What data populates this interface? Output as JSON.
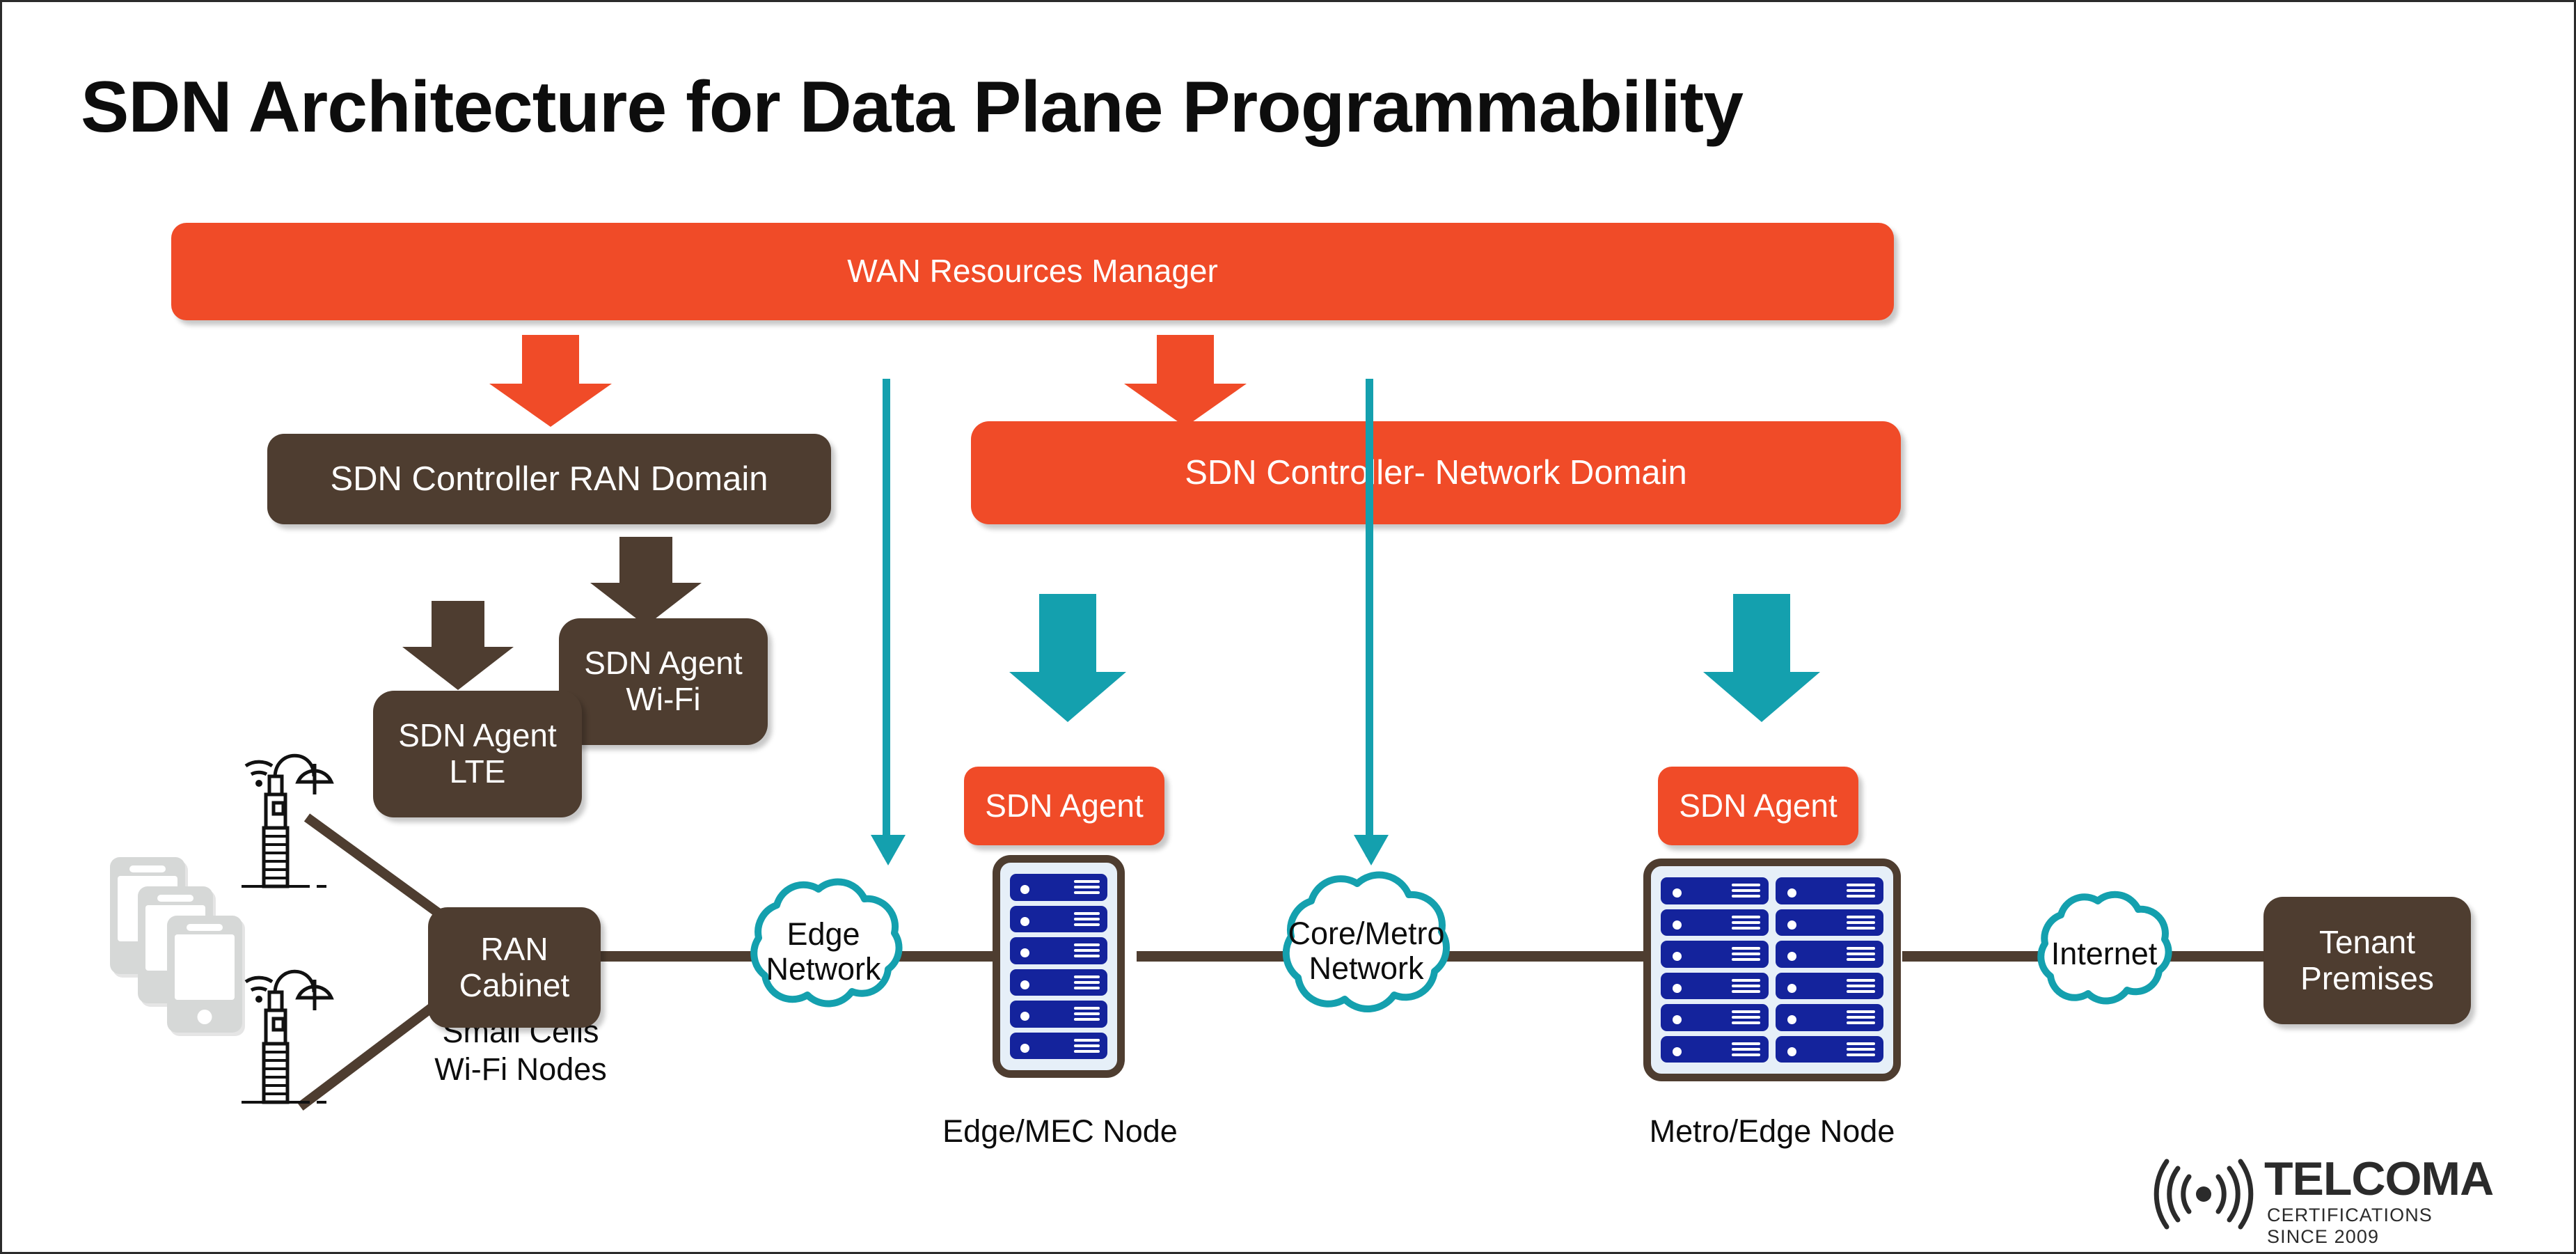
{
  "page": {
    "title": "SDN Architecture for Data Plane Programmability"
  },
  "colors": {
    "orange": "#F04B28",
    "brown": "#4E3D30",
    "teal": "#14A0AE",
    "server_navy": "#14239C",
    "rack_fill": "#E6EFF8",
    "phone_gray": "#D6D8D7",
    "text_dark": "#0D0D0D"
  },
  "boxes": {
    "wan_manager": "WAN Resources Manager",
    "controller_ran": "SDN Controller RAN Domain",
    "controller_network": "SDN Controller- Network Domain",
    "agent_wifi": "SDN Agent\nWi-Fi",
    "agent_lte": "SDN Agent\nLTE",
    "ran_cabinet": "RAN\nCabinet",
    "sdn_agent_edge": "SDN Agent",
    "sdn_agent_metro": "SDN Agent",
    "tenant_premises": "Tenant\nPremises"
  },
  "clouds": {
    "edge": "Edge\nNetwork",
    "core_metro": "Core/Metro\nNetwork",
    "internet": "Internet"
  },
  "captions": {
    "small_cells": "Small Cells\nWi-Fi Nodes",
    "edge_mec_node": "Edge/MEC Node",
    "metro_edge_node": "Metro/Edge Node"
  },
  "racks": {
    "edge_mec": {
      "columns": 1,
      "rows": 6
    },
    "metro_edge": {
      "columns": 2,
      "rows": 6
    }
  },
  "devices": {
    "phone_count": 3,
    "tower_count": 2
  },
  "logo": {
    "wordmark": "TELCOMA",
    "tagline": "CERTIFICATIONS SINCE 2009"
  }
}
